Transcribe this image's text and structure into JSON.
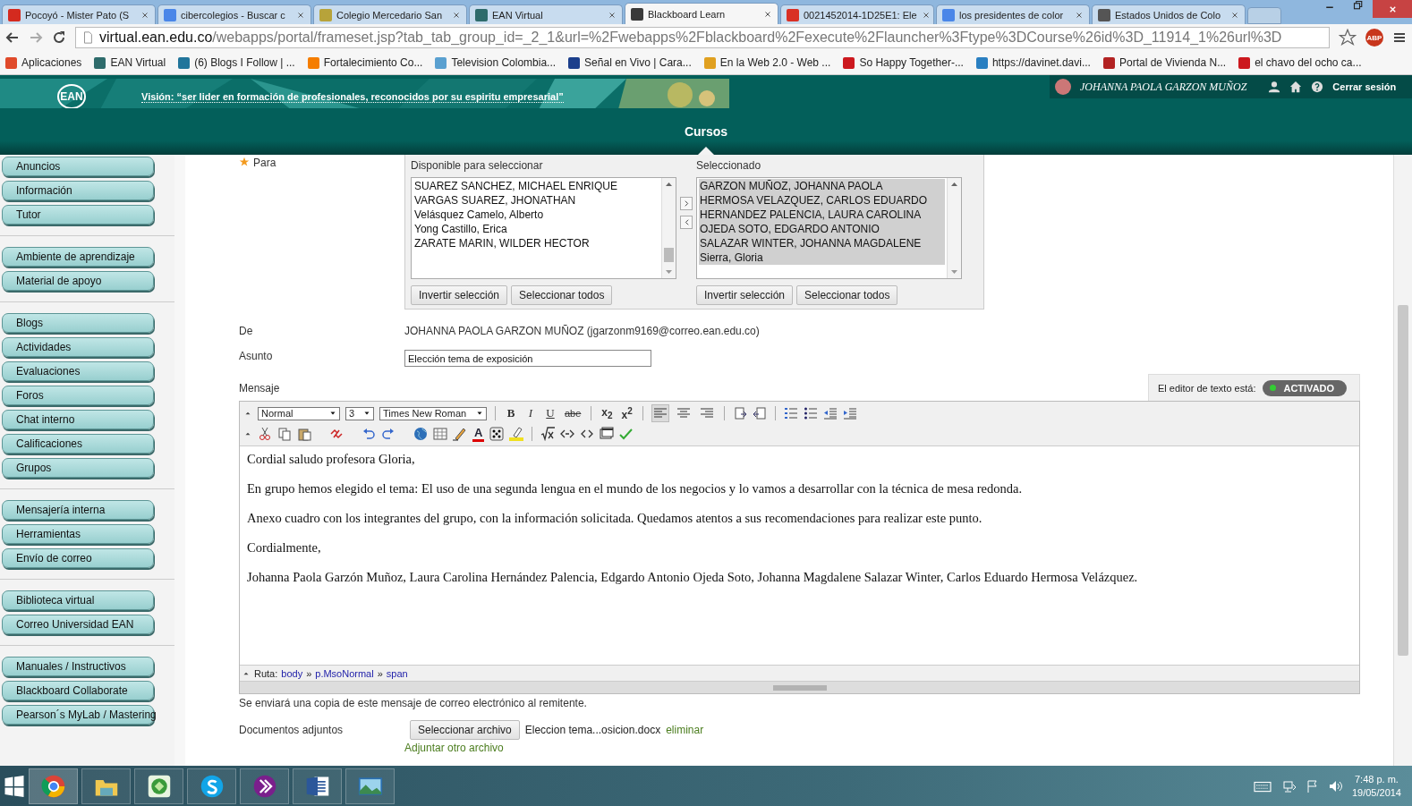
{
  "browser": {
    "tabs": [
      {
        "title": "Pocoyó - Mister Pato (S",
        "color": "#d42a1f",
        "selected": false
      },
      {
        "title": "cibercolegios - Buscar c",
        "color": "#4a86e8",
        "selected": false
      },
      {
        "title": "Colegio Mercedario San",
        "color": "#b7a33a",
        "selected": false
      },
      {
        "title": "EAN Virtual",
        "color": "#2e6b6b",
        "selected": false
      },
      {
        "title": "Blackboard Learn",
        "color": "#3a3a3a",
        "selected": true
      },
      {
        "title": "0021452014-1D25E1: Ele",
        "color": "#d93025",
        "selected": false
      },
      {
        "title": "los presidentes de color",
        "color": "#4a86e8",
        "selected": false
      },
      {
        "title": "Estados Unidos de Colo",
        "color": "#555555",
        "selected": false
      }
    ],
    "address": {
      "host": "virtual.ean.edu.co",
      "path": "/webapps/portal/frameset.jsp?tab_tab_group_id=_2_1&url=%2Fwebapps%2Fblackboard%2Fexecute%2Flauncher%3Ftype%3DCourse%26id%3D_11914_1%26url%3D"
    },
    "extension_badge": "ABP",
    "bookmarks": [
      {
        "label": "Aplicaciones",
        "color": "#e04a2a"
      },
      {
        "label": "EAN Virtual",
        "color": "#2e6b6b"
      },
      {
        "label": "(6) Blogs I Follow | ...",
        "color": "#21759b"
      },
      {
        "label": "Fortalecimiento Co...",
        "color": "#f57d00"
      },
      {
        "label": "Television Colombia...",
        "color": "#5aa0d0"
      },
      {
        "label": "Señal en Vivo | Cara...",
        "color": "#1c3f8c"
      },
      {
        "label": "En la Web 2.0 - Web ...",
        "color": "#e0a020"
      },
      {
        "label": "So Happy Together-...",
        "color": "#cc181e"
      },
      {
        "label": "https://davinet.davi...",
        "color": "#2a7fc1"
      },
      {
        "label": "Portal de Vivienda N...",
        "color": "#b22222"
      },
      {
        "label": "el chavo del ocho ca...",
        "color": "#cc181e"
      }
    ]
  },
  "header": {
    "logo_text": "EAN",
    "vision": "Visión: “ser lider en formación de profesionales, reconocidos por su espiritu empresarial”",
    "user_name": "JOHANNA PAOLA GARZON MUÑOZ",
    "logout": "Cerrar sesión",
    "nav_tab": "Cursos"
  },
  "sidebar": {
    "groups": [
      {
        "items": [
          "Anuncios",
          "Información",
          "Tutor"
        ]
      },
      {
        "items": [
          "Ambiente de aprendizaje",
          "Material de apoyo"
        ]
      },
      {
        "items": [
          "Blogs",
          "Actividades",
          "Evaluaciones",
          "Foros",
          "Chat interno",
          "Calificaciones",
          "Grupos"
        ]
      },
      {
        "items": [
          "Mensajería interna",
          "Herramientas",
          "Envío de correo"
        ]
      },
      {
        "items": [
          "Biblioteca virtual",
          "Correo Universidad EAN"
        ]
      },
      {
        "items": [
          "Manuales / Instructivos",
          "Blackboard Collaborate",
          "Pearson´s MyLab / Mastering"
        ]
      }
    ]
  },
  "form": {
    "to": {
      "label": "Para",
      "available": {
        "heading": "Disponible para seleccionar",
        "items": [
          {
            "name": "SUAREZ SANCHEZ, MICHAEL ENRIQUE",
            "selected": false
          },
          {
            "name": "VARGAS SUAREZ, JHONATHAN",
            "selected": false
          },
          {
            "name": "Velásquez Camelo, Alberto",
            "selected": false
          },
          {
            "name": "Yong Castillo, Erica",
            "selected": false
          },
          {
            "name": "ZARATE MARIN, WILDER HECTOR",
            "selected": false
          }
        ],
        "buttons": [
          "Invertir selección",
          "Seleccionar todos"
        ]
      },
      "chosen": {
        "heading": "Seleccionado",
        "items": [
          {
            "name": "GARZON MUÑOZ, JOHANNA PAOLA",
            "selected": true
          },
          {
            "name": "HERMOSA VELAZQUEZ, CARLOS EDUARDO",
            "selected": true
          },
          {
            "name": "HERNANDEZ PALENCIA, LAURA CAROLINA",
            "selected": true
          },
          {
            "name": "OJEDA SOTO, EDGARDO ANTONIO",
            "selected": true
          },
          {
            "name": "SALAZAR WINTER, JOHANNA MAGDALENE",
            "selected": true
          },
          {
            "name": "Sierra, Gloria",
            "selected": true
          }
        ],
        "buttons": [
          "Invertir selección",
          "Seleccionar todos"
        ]
      }
    },
    "from": {
      "label": "De",
      "value": "JOHANNA PAOLA GARZON MUÑOZ (jgarzonm9169@correo.ean.edu.co)"
    },
    "subject": {
      "label": "Asunto",
      "value": "Elección tema de exposición"
    },
    "message": {
      "label": "Mensaje",
      "editor_status": {
        "label": "El editor de texto está:",
        "state": "ACTIVADO",
        "on": true
      },
      "toolbar": {
        "selects": [
          "Normal",
          "3",
          "Times New Roman"
        ],
        "format_buttons": [
          {
            "label": "B",
            "kind": "bold"
          },
          {
            "label": "I",
            "kind": "italic"
          },
          {
            "label": "U",
            "kind": "underline"
          },
          {
            "label": "abe",
            "kind": "strike"
          },
          {
            "label": "x$_{2}$",
            "kind": "script"
          },
          {
            "label": "x$^{2}$",
            "kind": "script"
          }
        ],
        "align": [
          {
            "selected": true
          },
          {
            "selected": false
          },
          {
            "selected": false
          }
        ],
        "color_button": "A"
      },
      "paragraphs": [
        "Cordial saludo profesora Gloria,",
        "En grupo hemos elegido el tema: El uso de una segunda lengua en el mundo de los negocios y lo vamos a desarrollar con la técnica de mesa redonda.",
        "Anexo cuadro con los integrantes del grupo, con la información solicitada. Quedamos atentos a sus recomendaciones para realizar este punto.",
        "Cordialmente,",
        "Johanna Paola Garzón Muñoz, Laura Carolina Hernández Palencia, Edgardo Antonio Ojeda Soto, Johanna Magdalene Salazar Winter, Carlos Eduardo Hermosa Velázquez."
      ],
      "path": {
        "label": "Ruta:",
        "links": [
          "body",
          "p.MsoNormal",
          "span"
        ],
        "separator": "»"
      }
    },
    "copy_note": "Se enviará una copia de este mensaje de correo electrónico al remitente.",
    "attachments": {
      "label": "Documentos adjuntos",
      "button": "Seleccionar archivo",
      "file": "Eleccion tema...osicion.docx",
      "remove": "eliminar",
      "add_more": "Adjuntar otro archivo"
    }
  },
  "taskbar": {
    "time": "7:48 p. m.",
    "date": "19/05/2014"
  }
}
